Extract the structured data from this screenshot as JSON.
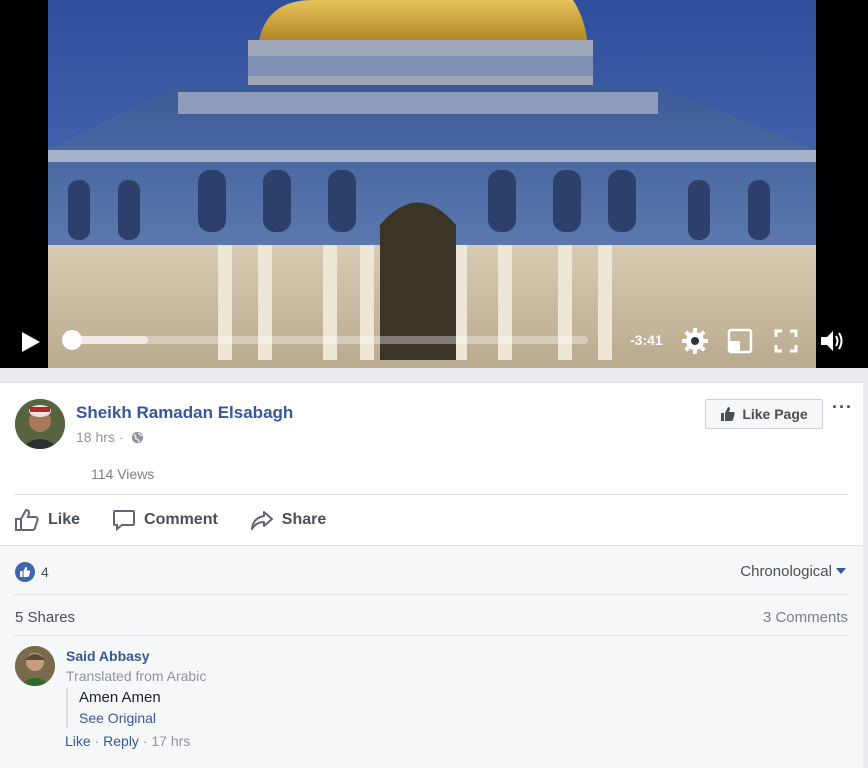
{
  "video": {
    "time_remaining": "-3:41",
    "progress": 0.16
  },
  "post": {
    "author": "Sheikh Ramadan Elsabagh",
    "time": "18 hrs",
    "separator": "·",
    "like_page_label": "Like Page",
    "more_label": "···",
    "views": "114 Views"
  },
  "actions": {
    "like": "Like",
    "comment": "Comment",
    "share": "Share"
  },
  "stats": {
    "reaction_count": "4",
    "sort_label": "Chronological",
    "shares": "5 Shares",
    "comments": "3 Comments"
  },
  "comment": {
    "author": "Said Abbasy",
    "translated": "Translated from Arabic",
    "text": "Amen Amen",
    "see_original": "See Original",
    "like": "Like",
    "reply": "Reply",
    "time": "17 hrs"
  },
  "colors": {
    "link": "#365899",
    "like_blue": "#4267b2"
  }
}
